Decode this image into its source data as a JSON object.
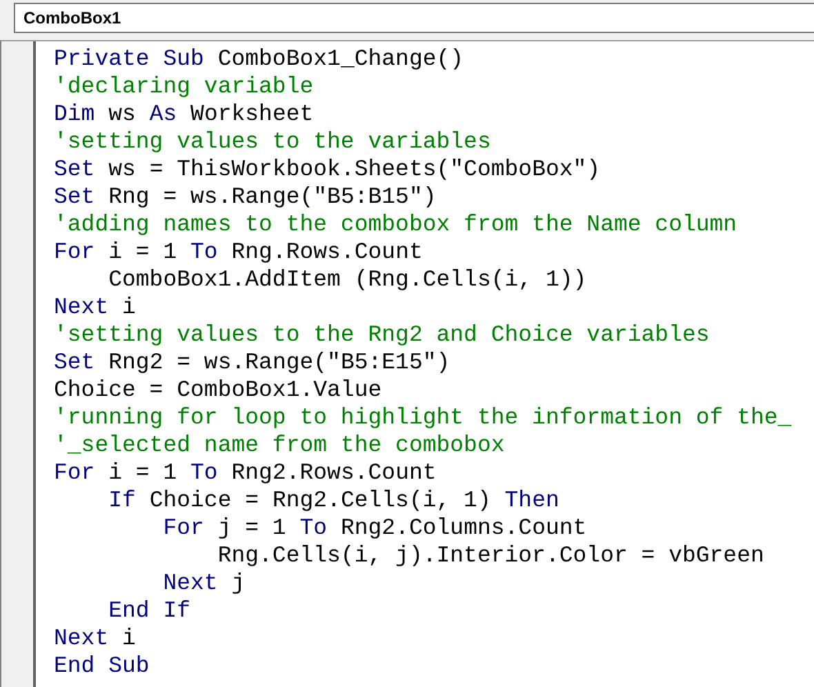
{
  "object_box": {
    "value": "ComboBox1"
  },
  "code_lines": [
    {
      "tokens": [
        {
          "kind": "keyword",
          "text": "Private Sub"
        },
        {
          "kind": "plain",
          "text": " ComboBox1_Change()"
        }
      ]
    },
    {
      "tokens": [
        {
          "kind": "comment",
          "text": "'declaring variable"
        }
      ]
    },
    {
      "tokens": [
        {
          "kind": "keyword",
          "text": "Dim"
        },
        {
          "kind": "plain",
          "text": " ws "
        },
        {
          "kind": "keyword",
          "text": "As"
        },
        {
          "kind": "plain",
          "text": " Worksheet"
        }
      ]
    },
    {
      "tokens": [
        {
          "kind": "comment",
          "text": "'setting values to the variables"
        }
      ]
    },
    {
      "tokens": [
        {
          "kind": "keyword",
          "text": "Set"
        },
        {
          "kind": "plain",
          "text": " ws = ThisWorkbook.Sheets(\"ComboBox\")"
        }
      ]
    },
    {
      "tokens": [
        {
          "kind": "keyword",
          "text": "Set"
        },
        {
          "kind": "plain",
          "text": " Rng = ws.Range(\"B5:B15\")"
        }
      ]
    },
    {
      "tokens": [
        {
          "kind": "comment",
          "text": "'adding names to the combobox from the Name column"
        }
      ]
    },
    {
      "tokens": [
        {
          "kind": "keyword",
          "text": "For"
        },
        {
          "kind": "plain",
          "text": " i = 1 "
        },
        {
          "kind": "keyword",
          "text": "To"
        },
        {
          "kind": "plain",
          "text": " Rng.Rows.Count"
        }
      ]
    },
    {
      "tokens": [
        {
          "kind": "plain",
          "text": "    ComboBox1.AddItem (Rng.Cells(i, 1))"
        }
      ]
    },
    {
      "tokens": [
        {
          "kind": "keyword",
          "text": "Next"
        },
        {
          "kind": "plain",
          "text": " i"
        }
      ]
    },
    {
      "tokens": [
        {
          "kind": "comment",
          "text": "'setting values to the Rng2 and Choice variables"
        }
      ]
    },
    {
      "tokens": [
        {
          "kind": "keyword",
          "text": "Set"
        },
        {
          "kind": "plain",
          "text": " Rng2 = ws.Range(\"B5:E15\")"
        }
      ]
    },
    {
      "tokens": [
        {
          "kind": "plain",
          "text": "Choice = ComboBox1.Value"
        }
      ]
    },
    {
      "tokens": [
        {
          "kind": "comment",
          "text": "'running for loop to highlight the information of the_"
        }
      ]
    },
    {
      "tokens": [
        {
          "kind": "comment",
          "text": "'_selected name from the combobox"
        }
      ]
    },
    {
      "tokens": [
        {
          "kind": "keyword",
          "text": "For"
        },
        {
          "kind": "plain",
          "text": " i = 1 "
        },
        {
          "kind": "keyword",
          "text": "To"
        },
        {
          "kind": "plain",
          "text": " Rng2.Rows.Count"
        }
      ]
    },
    {
      "tokens": [
        {
          "kind": "keyword",
          "text": "    If"
        },
        {
          "kind": "plain",
          "text": " Choice = Rng2.Cells(i, 1) "
        },
        {
          "kind": "keyword",
          "text": "Then"
        }
      ]
    },
    {
      "tokens": [
        {
          "kind": "keyword",
          "text": "        For"
        },
        {
          "kind": "plain",
          "text": " j = 1 "
        },
        {
          "kind": "keyword",
          "text": "To"
        },
        {
          "kind": "plain",
          "text": " Rng2.Columns.Count"
        }
      ]
    },
    {
      "tokens": [
        {
          "kind": "plain",
          "text": "            Rng.Cells(i, j).Interior.Color = vbGreen"
        }
      ]
    },
    {
      "tokens": [
        {
          "kind": "keyword",
          "text": "        Next"
        },
        {
          "kind": "plain",
          "text": " j"
        }
      ]
    },
    {
      "tokens": [
        {
          "kind": "keyword",
          "text": "    End If"
        }
      ]
    },
    {
      "tokens": [
        {
          "kind": "keyword",
          "text": "Next"
        },
        {
          "kind": "plain",
          "text": " i"
        }
      ]
    },
    {
      "tokens": [
        {
          "kind": "keyword",
          "text": "End Sub"
        }
      ]
    }
  ]
}
